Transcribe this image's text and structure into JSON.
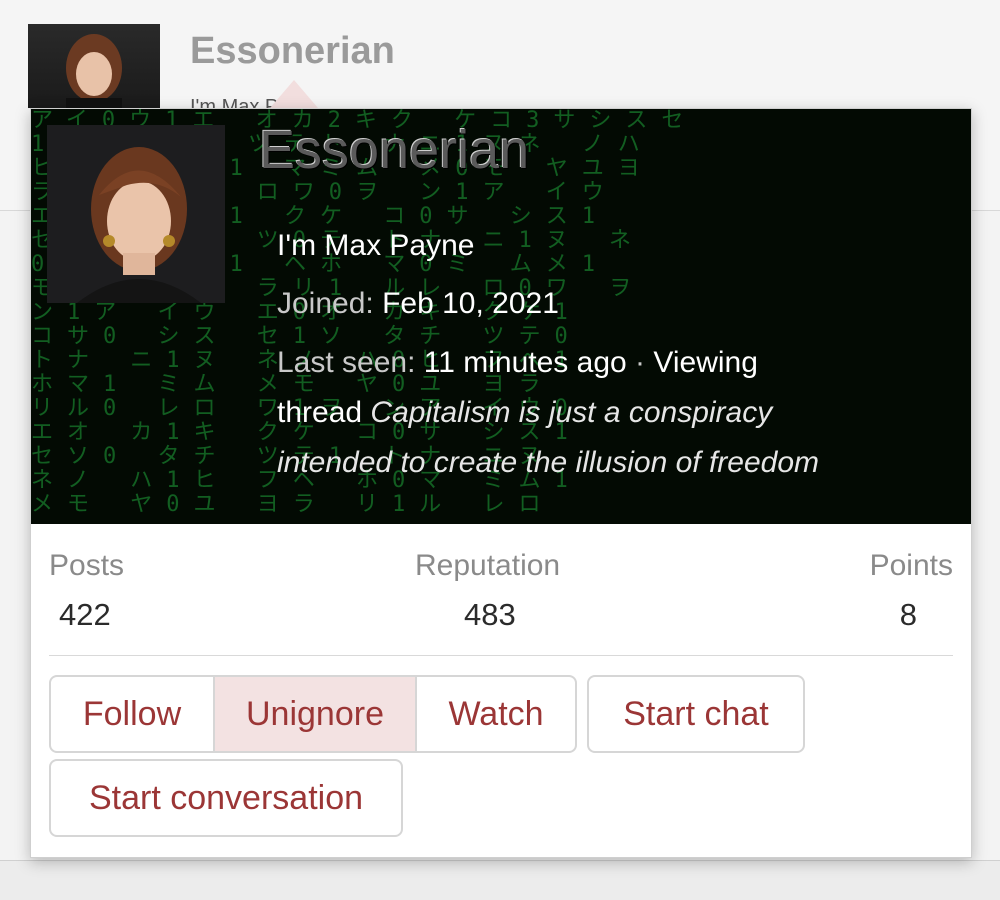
{
  "background": {
    "username": "Essonerian",
    "snippet": "I'm Max P"
  },
  "card": {
    "username": "Essonerian",
    "custom_title": "I'm Max Payne",
    "joined_label": "Joined:",
    "joined_value": "Feb 10, 2021",
    "last_seen_label": "Last seen:",
    "last_seen_value": "11 minutes ago",
    "activity_sep": " · ",
    "activity_prefix": "Viewing",
    "activity_thread_word": "thread",
    "activity_thread_title_1": "Capitalism is just a conspiracy",
    "activity_thread_title_2": "intended to create the illusion of freedom",
    "stats": [
      {
        "label": "Posts",
        "value": "422"
      },
      {
        "label": "Reputation",
        "value": "483"
      },
      {
        "label": "Points",
        "value": "8"
      }
    ],
    "buttons": {
      "follow": "Follow",
      "unignore": "Unignore",
      "watch": "Watch",
      "start_chat": "Start chat",
      "start_conversation": "Start conversation"
    }
  },
  "colors": {
    "button_text": "#9b3636",
    "active_button_bg": "#f3e2e2",
    "matrix_green": "#1fa33a"
  }
}
